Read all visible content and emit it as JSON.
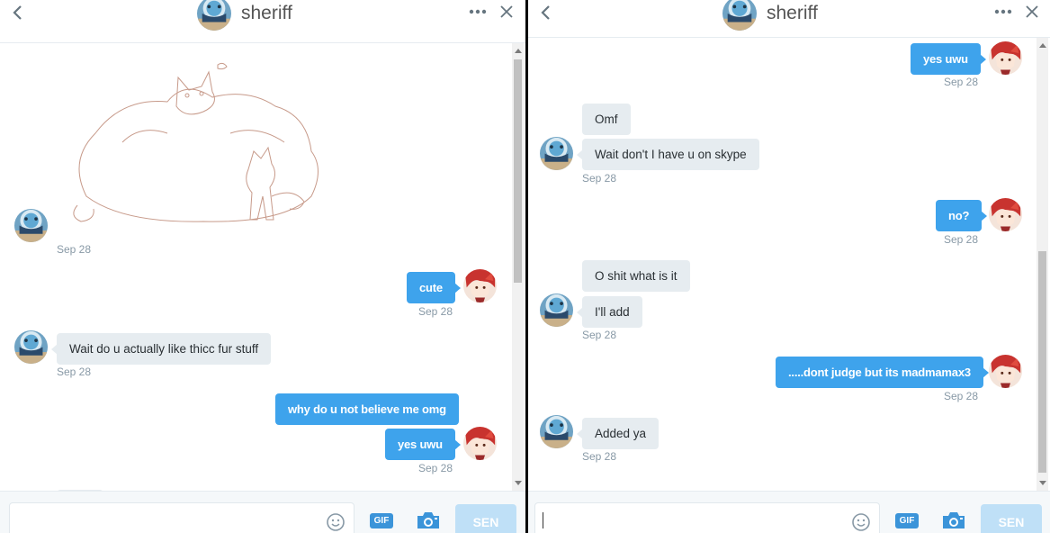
{
  "conversation": {
    "title": "sheriff"
  },
  "left_pane": {
    "messages": [
      {
        "type": "image",
        "image": "drawing-of-chubby-wolf-and-small-fox"
      },
      {
        "type": "timestamp",
        "text": "Sep 28"
      },
      {
        "type": "outgoing",
        "text": "cute"
      },
      {
        "type": "timestamp",
        "text": "Sep 28"
      },
      {
        "type": "incoming",
        "text": "Wait do u actually like thicc fur stuff"
      },
      {
        "type": "timestamp",
        "text": "Sep 28"
      },
      {
        "type": "outgoing",
        "text": "why do u not believe me omg"
      },
      {
        "type": "outgoing",
        "text": "yes uwu"
      },
      {
        "type": "timestamp",
        "text": "Sep 28"
      }
    ]
  },
  "right_pane": {
    "messages": [
      {
        "type": "outgoing",
        "text": "yes uwu"
      },
      {
        "type": "timestamp",
        "text": "Sep 28"
      },
      {
        "type": "incoming",
        "text": "Omf"
      },
      {
        "type": "incoming",
        "text": "Wait don't I have u on skype"
      },
      {
        "type": "timestamp",
        "text": "Sep 28"
      },
      {
        "type": "outgoing",
        "text": "no?"
      },
      {
        "type": "timestamp",
        "text": "Sep 28"
      },
      {
        "type": "incoming",
        "text": "O shit what is it"
      },
      {
        "type": "incoming",
        "text": "I'll add"
      },
      {
        "type": "timestamp",
        "text": "Sep 28"
      },
      {
        "type": "outgoing",
        "text": ".....dont judge but its madmamax3"
      },
      {
        "type": "timestamp",
        "text": "Sep 28"
      },
      {
        "type": "incoming",
        "text": "Added ya"
      },
      {
        "type": "timestamp",
        "text": "Sep 28"
      }
    ]
  },
  "composer": {
    "gif_label": "GIF",
    "send_label": "SEN",
    "left_input_value": "",
    "right_input_value": ""
  },
  "colors": {
    "accent": "#3ea3ec",
    "incoming_bubble": "#e6ecf0",
    "send_disabled": "#bfe0f7",
    "timestamp": "#8899a6"
  },
  "icons": [
    "back-icon",
    "more-icon",
    "close-icon",
    "emoji-icon",
    "camera-icon"
  ]
}
